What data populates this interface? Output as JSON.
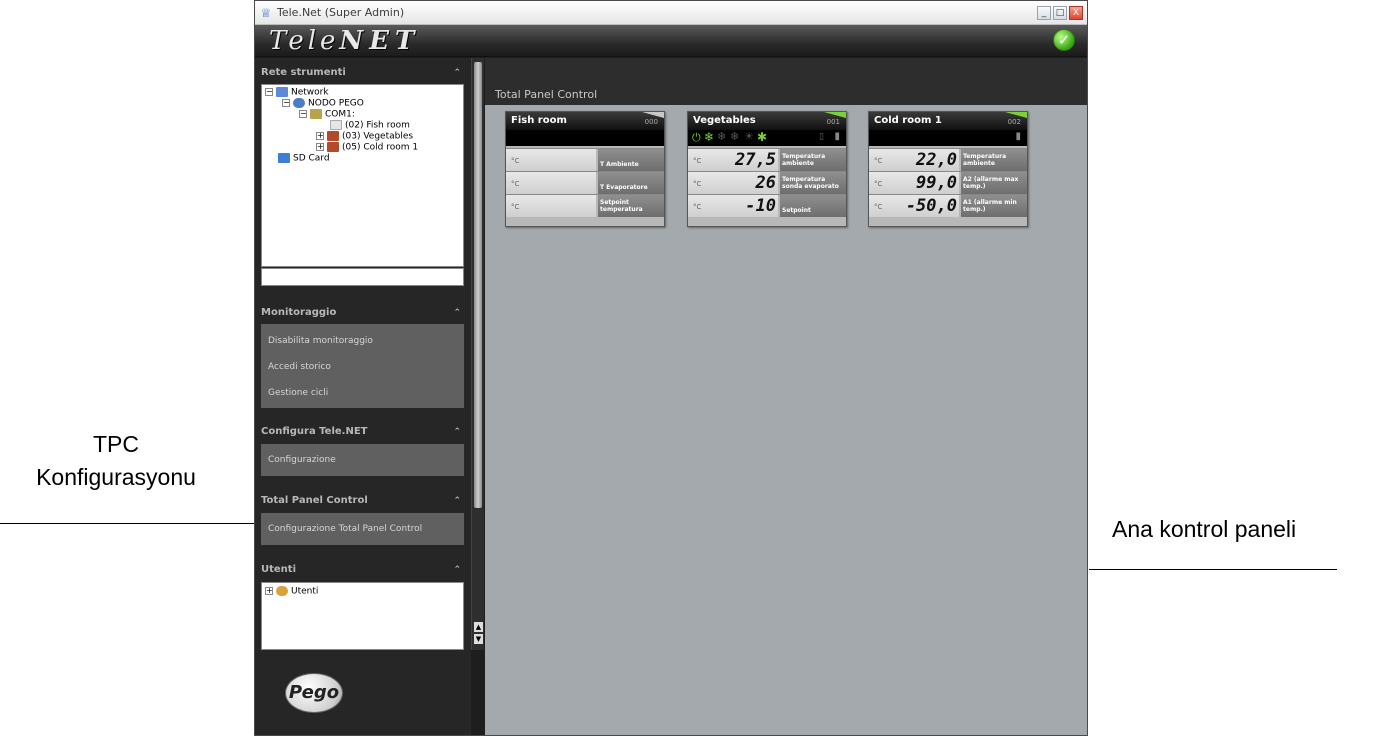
{
  "annotations": {
    "left_line1": "TPC",
    "left_line2": "Konfigurasyonu",
    "right": "Ana kontrol paneli"
  },
  "window": {
    "title": "Tele.Net (Super Admin)",
    "controls": [
      "_",
      "□",
      "X"
    ]
  },
  "header": {
    "logo_light": "Tele",
    "logo_bold": "NET"
  },
  "sidebar": {
    "rete": {
      "title": "Rete strumenti",
      "tree": {
        "network": "Network",
        "nodo": "NODO PEGO",
        "com": "COM1:",
        "fish": "(02) Fish room",
        "veg": "(03) Vegetables",
        "cold": "(05) Cold room 1",
        "sd": "SD Card"
      }
    },
    "monitoraggio": {
      "title": "Monitoraggio",
      "items": [
        "Disabilita monitoraggio",
        "Accedi storico",
        "Gestione cicli"
      ]
    },
    "configura": {
      "title": "Configura Tele.NET",
      "items": [
        "Configurazione"
      ]
    },
    "tpc": {
      "title": "Total Panel Control",
      "items": [
        "Configurazione Total Panel Control"
      ]
    },
    "utenti": {
      "title": "Utenti",
      "tree_item": "Utenti"
    },
    "brand": "Pego"
  },
  "main": {
    "title": "Total Panel Control",
    "panels": [
      {
        "name": "Fish room",
        "address": "000",
        "rows": [
          {
            "unit": "°C",
            "value": "",
            "label": "T Ambiente"
          },
          {
            "unit": "°C",
            "value": "",
            "label": "T Evaporatore"
          },
          {
            "unit": "°C",
            "value": "",
            "label": "Setpoint temperatura"
          }
        ]
      },
      {
        "name": "Vegetables",
        "address": "001",
        "rows": [
          {
            "unit": "°C",
            "value": "27,5",
            "label": "Temperatura ambiente"
          },
          {
            "unit": "°C",
            "value": "26",
            "label": "Temperatura sonda evaporato"
          },
          {
            "unit": "°C",
            "value": "-10",
            "label": "Setpoint"
          }
        ]
      },
      {
        "name": "Cold room 1",
        "address": "002",
        "rows": [
          {
            "unit": "°C",
            "value": "22,0",
            "label": "Temperatura ambiente"
          },
          {
            "unit": "°C",
            "value": "99,0",
            "label": "A2 (allarme max temp.)"
          },
          {
            "unit": "°C",
            "value": "-50,0",
            "label": "A1 (allarme min temp.)"
          }
        ]
      }
    ]
  },
  "colors": {
    "status_green": "#7ad13a",
    "panel_grey": "#b8b8b8",
    "main_bg": "#a3a9ad"
  }
}
